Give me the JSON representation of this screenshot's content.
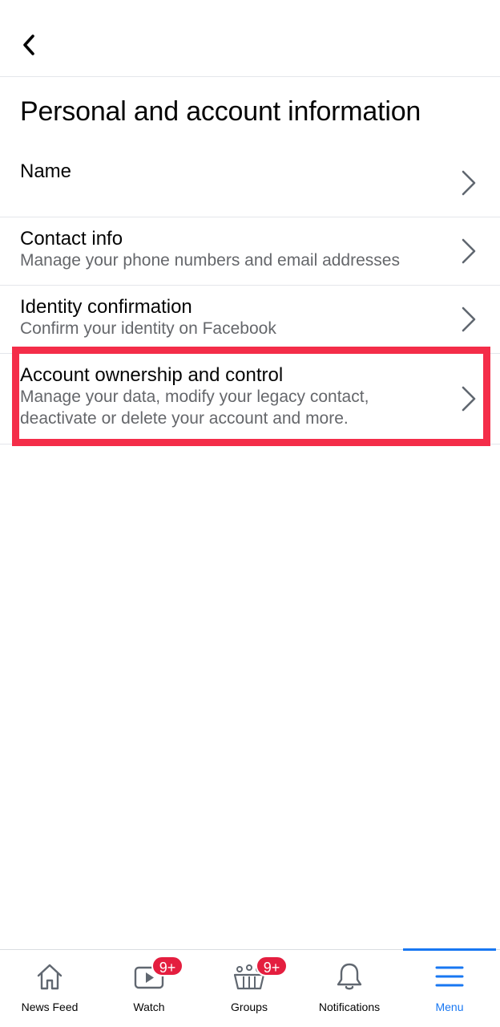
{
  "header": {
    "back_icon": "chevron-left-icon"
  },
  "page": {
    "title": "Personal and account information"
  },
  "settings": [
    {
      "title": "Name",
      "subtitle": ""
    },
    {
      "title": "Contact info",
      "subtitle": "Manage your phone numbers and email addresses"
    },
    {
      "title": "Identity confirmation",
      "subtitle": "Confirm your identity on Facebook"
    },
    {
      "title": "Account ownership and control",
      "subtitle_line1": "Manage your data, modify your legacy contact,",
      "subtitle_line2": "deactivate or delete your account and more."
    }
  ],
  "highlight_color": "#f42d49",
  "tabbar": {
    "tabs": [
      {
        "label": "News Feed",
        "icon": "home-icon"
      },
      {
        "label": "Watch",
        "icon": "video-icon",
        "badge": "9+"
      },
      {
        "label": "Groups",
        "icon": "groups-icon",
        "badge": "9+"
      },
      {
        "label": "Notifications",
        "icon": "bell-icon"
      },
      {
        "label": "Menu",
        "icon": "menu-icon",
        "active": true
      }
    ],
    "accent_color": "#1877f2",
    "badge_color": "#e41e3f"
  }
}
